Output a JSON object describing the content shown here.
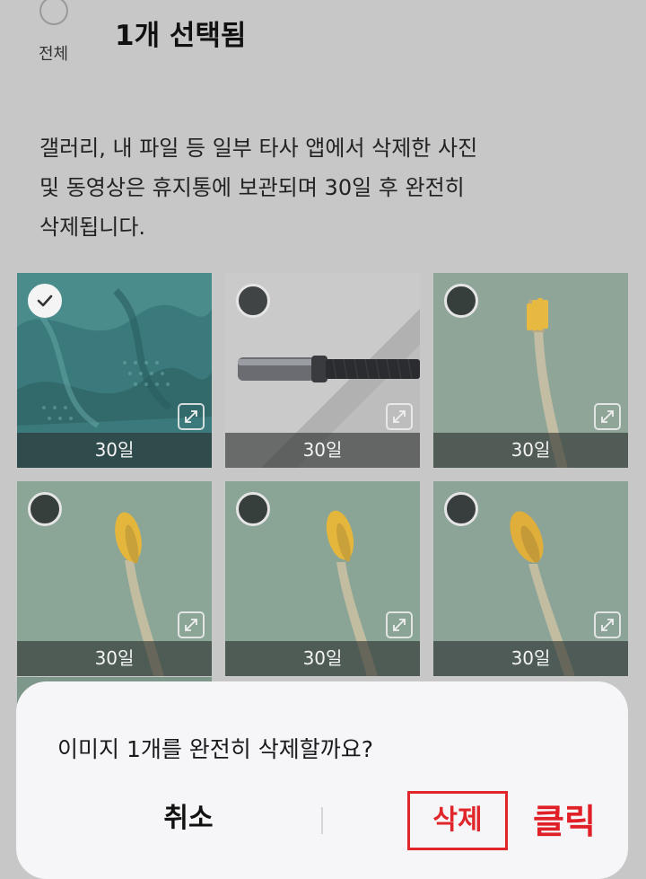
{
  "header": {
    "select_all_label": "전체",
    "title": "1개 선택됨"
  },
  "notice": {
    "lines": [
      "갤러리, 내 파일 등 일부 타사 앱에서 삭제한 사진",
      "및 동영상은 휴지통에 보관되며 30일 후 완전히",
      "삭제됩니다."
    ]
  },
  "grid": {
    "items": [
      {
        "subject": "teal textured cloth",
        "days_left": "30일",
        "selected": true
      },
      {
        "subject": "black cable with metal connector",
        "days_left": "30일",
        "selected": false
      },
      {
        "subject": "toothbrush with yellow bristles",
        "days_left": "30일",
        "selected": false
      },
      {
        "subject": "toothbrush with yellow bristles",
        "days_left": "30일",
        "selected": false
      },
      {
        "subject": "toothbrush with yellow bristles",
        "days_left": "30일",
        "selected": false
      },
      {
        "subject": "toothbrush with yellow bristles",
        "days_left": "30일",
        "selected": false
      }
    ],
    "selection_icon": "check-circle-icon",
    "expand_icon": "expand-arrows-icon"
  },
  "dialog": {
    "question": "이미지 1개를 완전히 삭제할까요?",
    "cancel_label": "취소",
    "delete_label": "삭제",
    "delete_highlight_color": "#e0262b"
  },
  "annotation": {
    "text": "클릭",
    "color": "#e01f26"
  }
}
